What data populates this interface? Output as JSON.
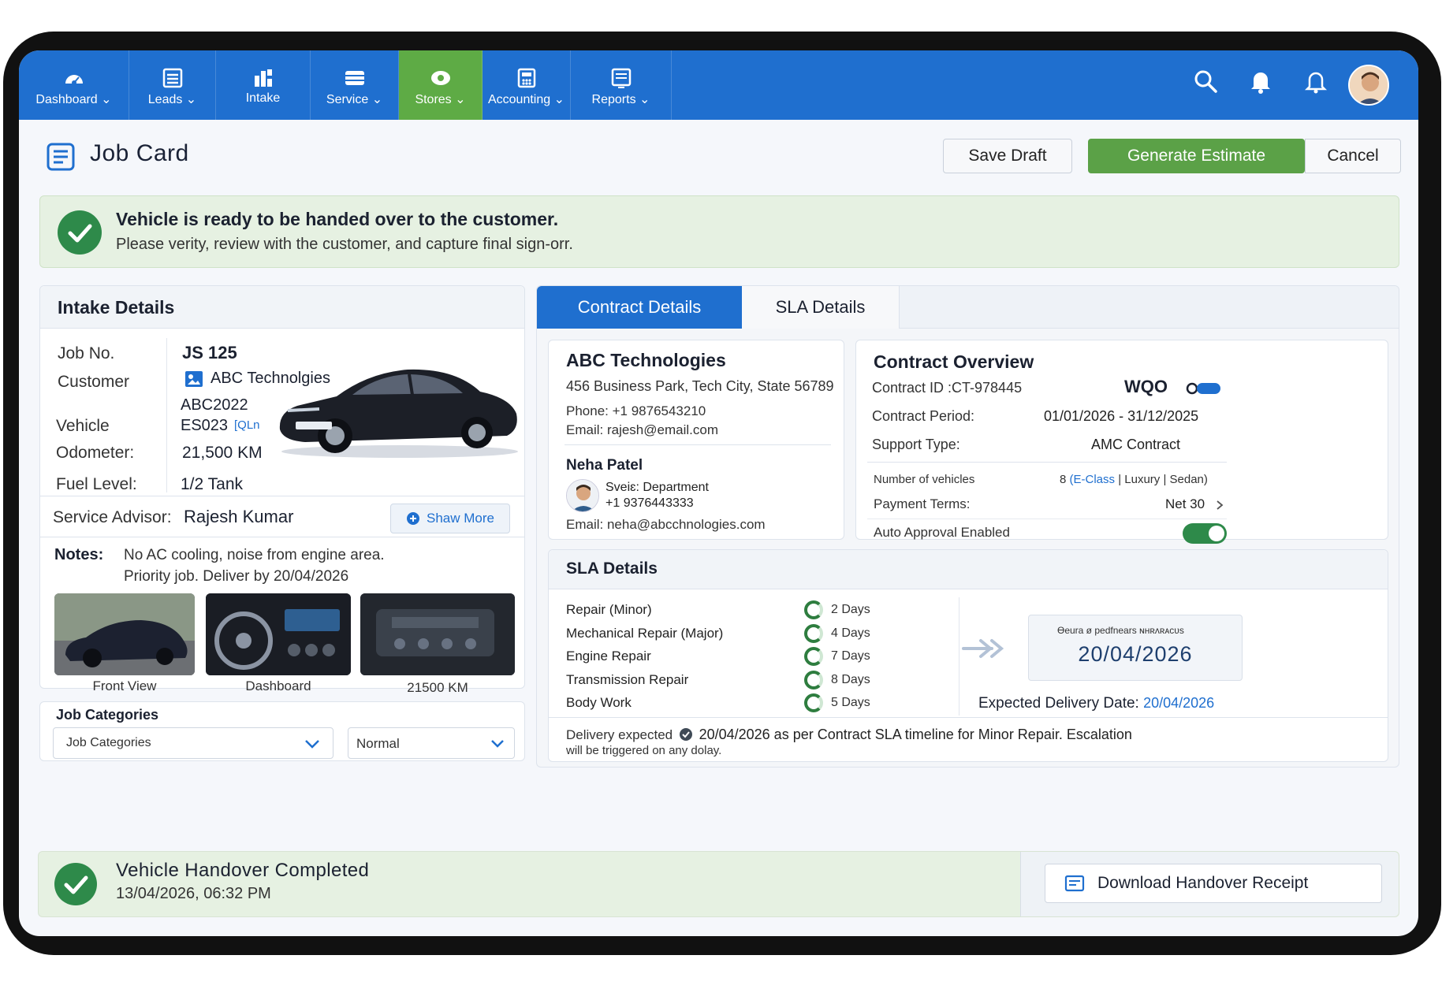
{
  "nav": {
    "items": [
      {
        "label": "Dashboard",
        "icon": "dashboard-icon"
      },
      {
        "label": "Leads",
        "icon": "leads-icon"
      },
      {
        "label": "Intake",
        "icon": "intake-icon"
      },
      {
        "label": "Service",
        "icon": "service-icon"
      },
      {
        "label": "Stores",
        "icon": "stores-icon"
      },
      {
        "label": "Accounting",
        "icon": "accounting-icon"
      },
      {
        "label": "Reports",
        "icon": "reports-icon"
      }
    ],
    "active": "Stores",
    "right_icons": [
      "search-icon",
      "bell-icon",
      "bell-outline-icon",
      "avatar"
    ]
  },
  "header": {
    "title": "Job Card",
    "save_label": "Save Draft",
    "generate_label": "Generate Estimate",
    "cancel_label": "Cancel"
  },
  "banner": {
    "title": "Vehicle is ready to be handed over to the customer.",
    "subtitle": "Please verity, review with the customer, and capture final sign-orr."
  },
  "intake": {
    "title": "Intake Details",
    "job_no_label": "Job No.",
    "job_no": "JS 125",
    "customer_label": "Customer",
    "customer": "ABC Technolgies",
    "customer_code": "ABC2022",
    "vehicle_label": "Vehicle",
    "vehicle": "ES023",
    "vehicle_tag": "[QLn",
    "odometer_label": "Odometer:",
    "odometer": "21,500 KM",
    "fuel_label": "Fuel Level:",
    "fuel": "1/2 Tank",
    "advisor_label": "Service Advisor:",
    "advisor": "Rajesh Kumar",
    "show_more": "Shaw More",
    "notes_label": "Notes:",
    "notes_line1": "No AC cooling, noise from engine area.",
    "notes_line2": "Priority job. Deliver by 20/04/2026",
    "photos": [
      {
        "caption": "Front View"
      },
      {
        "caption": "Dashboard"
      },
      {
        "caption": "21500 KM"
      }
    ]
  },
  "job_categories": {
    "title": "Job Categories",
    "select_value": "Job Categories",
    "priority_value": "Normal"
  },
  "tabs": {
    "contract": "Contract Details",
    "sla": "SLA Details"
  },
  "contract_customer": {
    "name": "ABC Technologies",
    "address": "456 Business Park, Tech City, State 56789",
    "phone": "Phone: +1 9876543210",
    "email": "Email: rajesh@email.com",
    "contact_name": "Neha Patel",
    "contact_dept": "Sveiɛ: Department",
    "contact_phone": "+1 9376443333",
    "contact_email": "Email: neha@abcchnologies.com"
  },
  "contract_overview": {
    "title": "Contract Overview",
    "id_label": "Contract ID :CT-978445",
    "id_badge": "WQO",
    "period_label": "Contract Period:",
    "period": "01/01/2026 - 31/12/2025",
    "support_label": "Support Type:",
    "support": "AMC Contract",
    "vehicles_label": "Number of vehicles",
    "vehicles_count": "8",
    "vehicles_class": "(E-Class",
    "vehicles_rest": "| Luxury | Sedan)",
    "payment_label": "Payment Terms:",
    "payment": "Net 30",
    "auto_label": "Auto Approval Enabled",
    "auto_enabled": true
  },
  "sla": {
    "title": "SLA Details",
    "rows": [
      {
        "name": "Repair (Minor)",
        "days": "2 Days"
      },
      {
        "name": "Mechanical Repair (Major)",
        "days": "4 Days"
      },
      {
        "name": "Engine Repair",
        "days": "7 Days"
      },
      {
        "name": "Transmission Repair",
        "days": "8 Days"
      },
      {
        "name": "Body Work",
        "days": "5 Days"
      }
    ],
    "box_caption": "Ɵeura ø pedfnears ɴʜʀʌʀᴀcᴜs",
    "box_date": "20/04/2026",
    "expected_label": "Expected Delivery Date:",
    "expected_date": "20/04/2026",
    "note_prefix": "Delivery expected",
    "note_main": "20/04/2026 as per Contract SLA timeline for Minor Repair. Escalation",
    "note_line2": "will be triggered on any dolay."
  },
  "footer": {
    "title": "Vehicle Handover Completed",
    "timestamp": "13/04/2026, 06:32 PM",
    "download_label": "Download Handover Receipt"
  },
  "colors": {
    "nav_blue": "#1f6fcf",
    "active_green": "#5eab45",
    "success_green": "#2e8a4a",
    "banner_bg": "#e6f1e2"
  }
}
